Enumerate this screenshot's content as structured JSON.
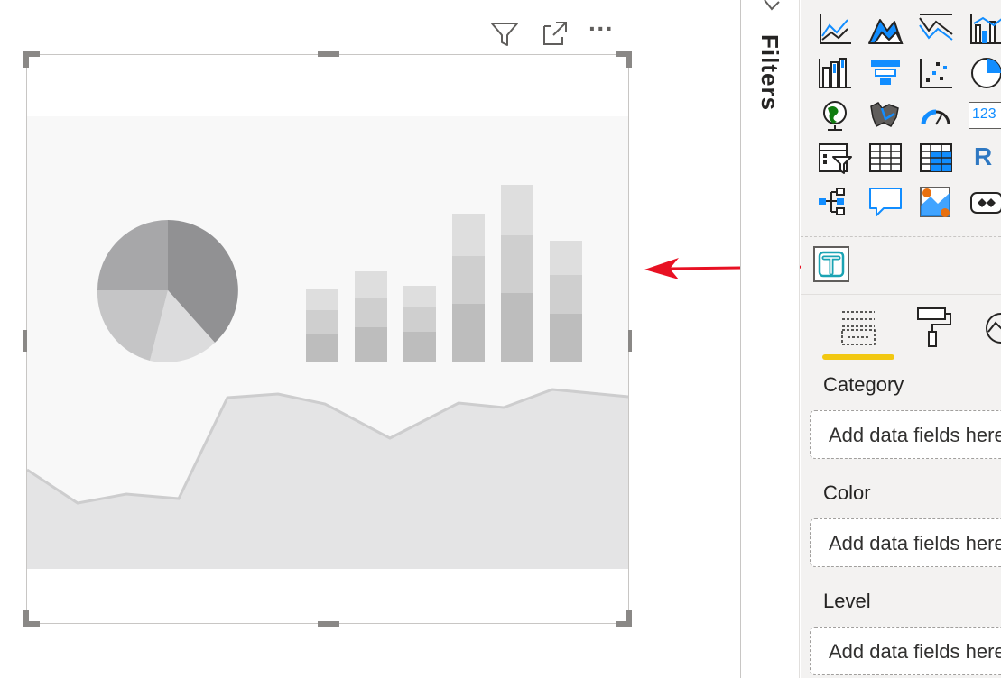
{
  "filters_pane": {
    "label": "Filters"
  },
  "visual": {
    "header_icons": [
      "filter-icon",
      "focus-mode-icon",
      "more-options-icon"
    ],
    "more_options_glyph": "···",
    "placeholder_graphic": [
      "pie-chart",
      "stacked-bar-chart",
      "area-chart"
    ]
  },
  "visualizations_pane": {
    "gallery": [
      [
        "line-chart-icon",
        "area-chart-icon",
        "stacked-area-chart-icon",
        "line-clustered-column-icon"
      ],
      [
        "ribbon-chart-icon",
        "funnel-chart-icon",
        "scatter-chart-icon",
        "pie-chart-icon"
      ],
      [
        "map-icon",
        "filled-map-icon",
        "gauge-icon",
        "card-icon"
      ],
      [
        "slicer-icon",
        "table-icon",
        "matrix-icon",
        "r-script-visual-icon"
      ],
      [
        "decomposition-tree-icon",
        "qa-visual-icon",
        "arcgis-map-icon",
        "power-apps-icon"
      ]
    ],
    "card_text": "123",
    "r_text": "R",
    "custom_visual_icon": "text-filter-icon",
    "tabs": [
      "fields-tab",
      "format-tab",
      "analytics-tab"
    ],
    "wells": [
      {
        "label": "Category",
        "placeholder": "Add data fields here"
      },
      {
        "label": "Color",
        "placeholder": "Add data fields here"
      },
      {
        "label": "Level",
        "placeholder": "Add data fields here"
      }
    ]
  },
  "colors": {
    "accent_blue": "#118dff",
    "highlight_yellow": "#f2c811",
    "arrow_red": "#e81123",
    "teal": "#1aa3b3"
  }
}
